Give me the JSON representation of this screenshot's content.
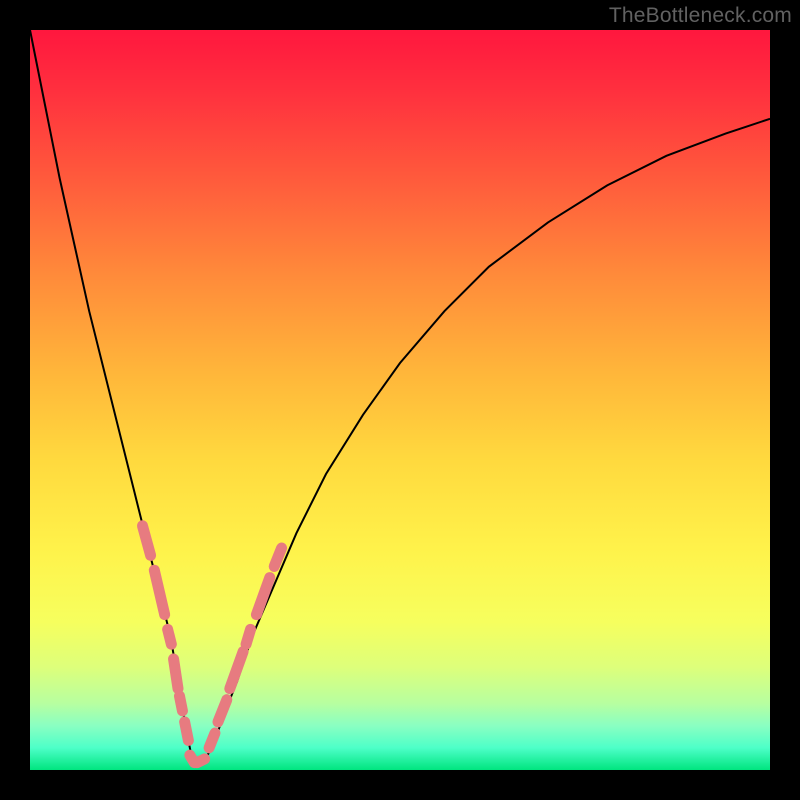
{
  "watermark": "TheBottleneck.com",
  "colors": {
    "frame": "#000000",
    "curve": "#000000",
    "bead": "#e77b80",
    "gradient_stops": [
      "#ff173e",
      "#ff2f3e",
      "#ff5a3c",
      "#ff8a3a",
      "#ffb53a",
      "#ffd93e",
      "#fff24a",
      "#f6ff5e",
      "#deff7a",
      "#b7ffa0",
      "#8affc2",
      "#4dffc8",
      "#00e57f"
    ]
  },
  "chart_data": {
    "type": "line",
    "title": "",
    "xlabel": "",
    "ylabel": "",
    "xlim": [
      0,
      100
    ],
    "ylim": [
      0,
      100
    ],
    "notes": "Approximate V-shaped bottleneck curve. x is horizontal position (0=left,100=right), y is height (0=bottom,100=top). Curve minimum near x≈22. Beads are short pink segments overlaid on the lower portion of both arms.",
    "series": [
      {
        "name": "curve",
        "x": [
          0,
          2,
          4,
          6,
          8,
          10,
          12,
          14,
          16,
          18,
          19,
          20,
          21,
          22,
          23,
          24,
          25,
          26,
          28,
          30,
          33,
          36,
          40,
          45,
          50,
          56,
          62,
          70,
          78,
          86,
          94,
          100
        ],
        "y": [
          100,
          90,
          80,
          71,
          62,
          54,
          46,
          38,
          30,
          22,
          18,
          12,
          6,
          1,
          1,
          2,
          4,
          7,
          12,
          18,
          25,
          32,
          40,
          48,
          55,
          62,
          68,
          74,
          79,
          83,
          86,
          88
        ]
      },
      {
        "name": "beads_left_arm",
        "segments": [
          {
            "x": [
              15.2,
              16.3
            ],
            "y": [
              33,
              29
            ]
          },
          {
            "x": [
              16.8,
              18.2
            ],
            "y": [
              27,
              21
            ]
          },
          {
            "x": [
              18.6,
              19.1
            ],
            "y": [
              19,
              17
            ]
          },
          {
            "x": [
              19.4,
              20.0
            ],
            "y": [
              15,
              11
            ]
          },
          {
            "x": [
              20.2,
              20.6
            ],
            "y": [
              10,
              8
            ]
          },
          {
            "x": [
              20.9,
              21.4
            ],
            "y": [
              6.5,
              4
            ]
          }
        ]
      },
      {
        "name": "bottom_beads",
        "segments": [
          {
            "x": [
              21.6,
              22.2
            ],
            "y": [
              2,
              1
            ]
          },
          {
            "x": [
              22.6,
              23.6
            ],
            "y": [
              1,
              1.5
            ]
          }
        ]
      },
      {
        "name": "beads_right_arm",
        "segments": [
          {
            "x": [
              24.2,
              25.0
            ],
            "y": [
              3,
              5
            ]
          },
          {
            "x": [
              25.4,
              26.6
            ],
            "y": [
              6.5,
              9.5
            ]
          },
          {
            "x": [
              27.0,
              28.8
            ],
            "y": [
              11,
              16
            ]
          },
          {
            "x": [
              29.2,
              29.8
            ],
            "y": [
              17,
              19
            ]
          },
          {
            "x": [
              30.6,
              32.4
            ],
            "y": [
              21,
              26
            ]
          },
          {
            "x": [
              33.0,
              34.0
            ],
            "y": [
              27.5,
              30
            ]
          }
        ]
      }
    ]
  }
}
